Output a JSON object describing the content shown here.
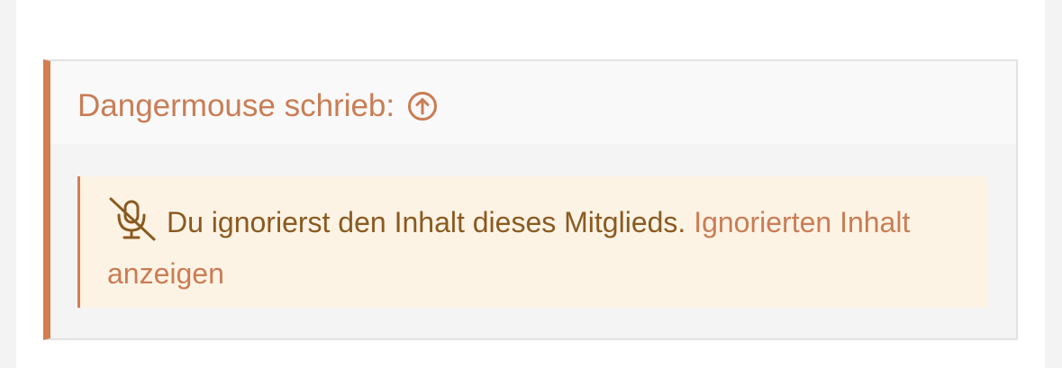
{
  "quote": {
    "author_text": "Dangermouse schrieb:",
    "jump_icon": "arrow-up-circle-icon",
    "ignored_icon": "microphone-slash-icon",
    "ignored_message": "Du ignorierst den Inhalt dieses Mitglieds.",
    "show_link": "Ignorierten Inhalt anzeigen"
  },
  "colors": {
    "accent": "#d27e50",
    "link": "#c97d55",
    "notice_bg": "#fdf3e5",
    "notice_text": "#8a5a20"
  }
}
